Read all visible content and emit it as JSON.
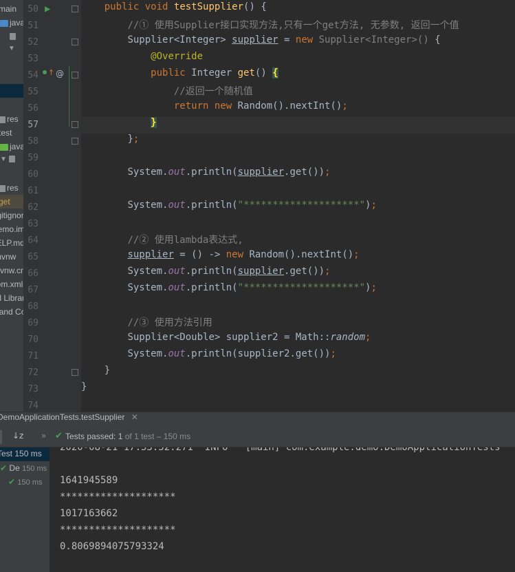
{
  "project": {
    "items": [
      "main",
      "java",
      "",
      "",
      "res",
      "test",
      "java",
      "",
      "res",
      "get",
      ".gitignore",
      "demo.iml",
      "HELP.md",
      "mvnw",
      "mvnw.cmd",
      "pom.xml",
      "External Libraries",
      "Scratches and Consoles"
    ]
  },
  "editor": {
    "line_numbers": [
      "50",
      "51",
      "52",
      "53",
      "54",
      "55",
      "56",
      "57",
      "58",
      "59",
      "60",
      "61",
      "62",
      "63",
      "64",
      "65",
      "66",
      "67",
      "68",
      "69",
      "70",
      "71",
      "72",
      "73",
      "74"
    ],
    "current_line": "57",
    "lines": [
      [
        [
          "    ",
          ""
        ],
        [
          "public ",
          "kw"
        ],
        [
          "void ",
          "kw"
        ],
        [
          "testSupplier",
          "fn"
        ],
        [
          "() {",
          ""
        ]
      ],
      [
        [
          "        ",
          ""
        ],
        [
          "//① 使用Supplier接口实现方法,只有一个get方法, 无参数, 返回一个值",
          "cm"
        ]
      ],
      [
        [
          "        ",
          ""
        ],
        [
          "Supplier<Integer> ",
          ""
        ],
        [
          "supplier",
          "fld"
        ],
        [
          " = ",
          ""
        ],
        [
          "new ",
          "kw"
        ],
        [
          "Supplier<Integer>() ",
          "gen"
        ],
        [
          "{",
          ""
        ]
      ],
      [
        [
          "            ",
          ""
        ],
        [
          "@Override",
          "an"
        ]
      ],
      [
        [
          "            ",
          ""
        ],
        [
          "public ",
          "kw"
        ],
        [
          "Integer ",
          ""
        ],
        [
          "get",
          "fn"
        ],
        [
          "() ",
          ""
        ],
        [
          "{",
          "brace-hl"
        ]
      ],
      [
        [
          "                ",
          ""
        ],
        [
          "//返回一个随机值",
          "cm"
        ]
      ],
      [
        [
          "                ",
          ""
        ],
        [
          "return ",
          "kw"
        ],
        [
          "new ",
          "kw"
        ],
        [
          "Random().nextInt()",
          ""
        ],
        [
          ";",
          "kw"
        ]
      ],
      [
        [
          "            ",
          ""
        ],
        [
          "}",
          "brace-hl"
        ]
      ],
      [
        [
          "        ",
          ""
        ],
        [
          "}",
          ""
        ],
        [
          ";",
          "kw"
        ]
      ],
      [],
      [
        [
          "        ",
          ""
        ],
        [
          "System.",
          ""
        ],
        [
          "out",
          "it"
        ],
        [
          ".println(",
          ""
        ],
        [
          "supplier",
          "fld"
        ],
        [
          ".get())",
          ""
        ],
        [
          ";",
          "kw"
        ]
      ],
      [],
      [
        [
          "        ",
          ""
        ],
        [
          "System.",
          ""
        ],
        [
          "out",
          "it"
        ],
        [
          ".println(",
          ""
        ],
        [
          "\"********************\"",
          "st"
        ],
        [
          ")",
          ""
        ],
        [
          ";",
          "kw"
        ]
      ],
      [],
      [
        [
          "        ",
          ""
        ],
        [
          "//② 使用lambda表达式,",
          "cm"
        ]
      ],
      [
        [
          "        ",
          ""
        ],
        [
          "supplier",
          "fld"
        ],
        [
          " = () -> ",
          ""
        ],
        [
          "new ",
          "kw"
        ],
        [
          "Random().nextInt()",
          ""
        ],
        [
          ";",
          "kw"
        ]
      ],
      [
        [
          "        ",
          ""
        ],
        [
          "System.",
          ""
        ],
        [
          "out",
          "it"
        ],
        [
          ".println(",
          ""
        ],
        [
          "supplier",
          "fld"
        ],
        [
          ".get())",
          ""
        ],
        [
          ";",
          "kw"
        ]
      ],
      [
        [
          "        ",
          ""
        ],
        [
          "System.",
          ""
        ],
        [
          "out",
          "it"
        ],
        [
          ".println(",
          ""
        ],
        [
          "\"********************\"",
          "st"
        ],
        [
          ")",
          ""
        ],
        [
          ";",
          "kw"
        ]
      ],
      [],
      [
        [
          "        ",
          ""
        ],
        [
          "//③ 使用方法引用",
          "cm"
        ]
      ],
      [
        [
          "        ",
          ""
        ],
        [
          "Supplier<Double> supplier2 = Math::",
          ""
        ],
        [
          "random",
          "it2"
        ],
        [
          ";",
          "kw"
        ]
      ],
      [
        [
          "        ",
          ""
        ],
        [
          "System.",
          ""
        ],
        [
          "out",
          "it"
        ],
        [
          ".println(supplier2.get())",
          ""
        ],
        [
          ";",
          "kw"
        ]
      ],
      [
        [
          "    ",
          ""
        ],
        [
          "}",
          ""
        ]
      ],
      [
        [
          "}",
          ""
        ]
      ],
      []
    ]
  },
  "run": {
    "tab_title": "DemoApplicationTests.testSupplier",
    "tests_passed_label": "Tests passed:",
    "tests_passed_count": "1",
    "tests_passed_detail": "of 1 test – 150 ms",
    "tree": [
      {
        "label": "Test",
        "time": "150 ms"
      },
      {
        "label": "De",
        "time": "150 ms"
      },
      {
        "label": "",
        "time": "150 ms"
      }
    ]
  },
  "console": {
    "lines": [
      "2020-08-21 17:53:52.271  INFO   [main] com.example.demo.DemoApplicationTests",
      "",
      "1641945589",
      "********************",
      "1017163662",
      "********************",
      "0.8069894075793324"
    ]
  },
  "colors": {
    "editor_bg": "#2b2b2b",
    "keyword": "#cc7832",
    "comment": "#808080",
    "string": "#6a8759",
    "method": "#ffc66d",
    "annotation": "#bbb529",
    "static_field": "#9876aa",
    "pass_green": "#499c54"
  }
}
